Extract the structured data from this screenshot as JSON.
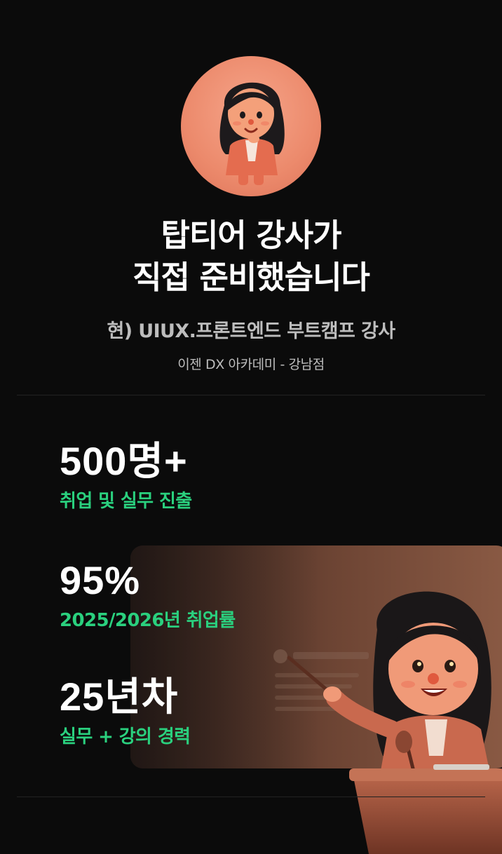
{
  "avatar": {
    "icon": "instructor-avatar-icon",
    "background": "#ec8a6c"
  },
  "headline": {
    "line1": "탑티어 강사가",
    "line2": "직접 준비했습니다"
  },
  "subtitle": "현) UIUX.프론트엔드 부트캠프 강사",
  "academy": "이젠 DX 아카데미 - 강남점",
  "stats": [
    {
      "value": "500명+",
      "label": "취업 및 실무 진출"
    },
    {
      "value": "95%",
      "label": "2025/2026년 취업률"
    },
    {
      "value": "25년차",
      "label": "실무 + 강의 경력"
    }
  ],
  "illustration": {
    "icon": "presenter-illustration-icon"
  },
  "colors": {
    "background": "#0b0b0b",
    "accent": "#2ad07e",
    "muted_text": "#bdbdbd",
    "divider": "#222222"
  }
}
